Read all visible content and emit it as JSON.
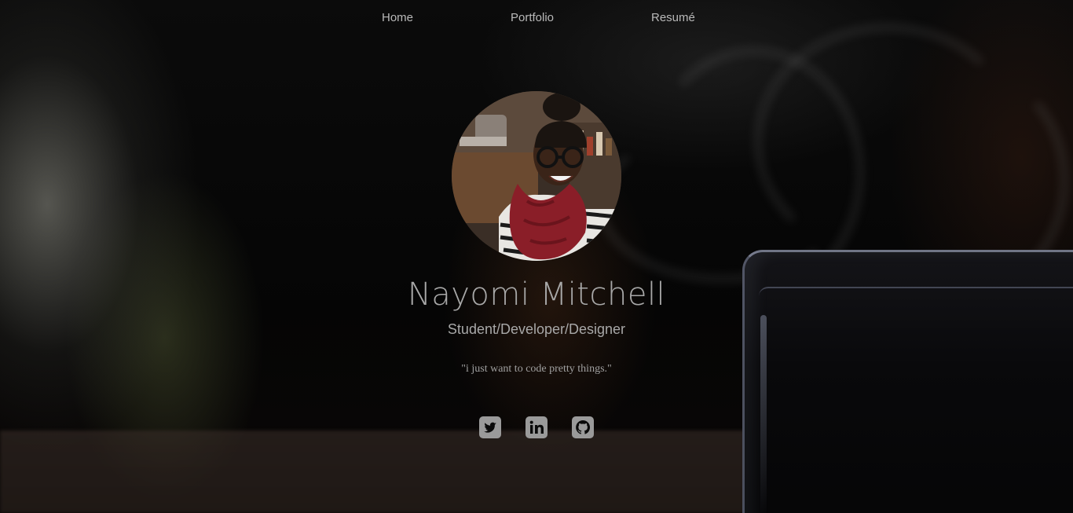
{
  "nav": {
    "home": "Home",
    "portfolio": "Portfolio",
    "resume": "Resumé"
  },
  "profile": {
    "name": "Nayomi Mitchell",
    "subtitle": "Student/Developer/Designer",
    "quote": "\"i just want to code pretty things.\""
  },
  "social": [
    {
      "icon": "twitter-icon"
    },
    {
      "icon": "linkedin-icon"
    },
    {
      "icon": "github-icon"
    }
  ],
  "colors": {
    "text": "#a8a8a8",
    "icon": "#9a9a9a",
    "background": "#050505"
  }
}
